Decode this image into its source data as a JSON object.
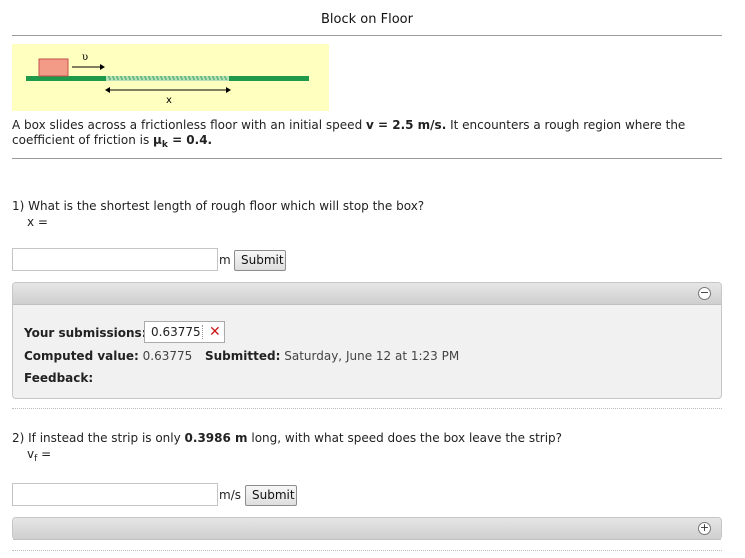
{
  "page": {
    "title": "Block on Floor"
  },
  "figure": {
    "velocity_label": "υ",
    "x_label": "x"
  },
  "problem": {
    "text_before": "A box slides across a frictionless floor with an initial speed ",
    "speed_value": "v = 2.5 m/s.",
    "text_middle": " It encounters a rough region where the",
    "line2_before": "coefficient of friction is ",
    "mu_symbol": "μ",
    "mu_sub": "k",
    "mu_value": " = 0.4."
  },
  "q1": {
    "question": "1) What is the shortest length of rough floor which will stop the box?",
    "variable": "x =",
    "input_value": "",
    "unit": "m",
    "submit_label": "Submit",
    "toggle": "−",
    "submissions_label": "Your submissions:",
    "submission_value": "0.63775",
    "submission_mark": "✕",
    "computed_label": "Computed value:",
    "computed_value": "0.63775",
    "submitted_label": "Submitted:",
    "submitted_value": "Saturday, June 12 at 1:23 PM",
    "feedback_label": "Feedback:"
  },
  "q2": {
    "question_before": "2) If instead the strip is only ",
    "length_value": "0.3986 m",
    "question_after": " long, with what speed does the box leave the strip?",
    "variable_v": "v",
    "variable_sub": "f",
    "variable_eq": " =",
    "input_value": "",
    "unit": "m/s",
    "submit_label": "Submit",
    "toggle": "+"
  }
}
